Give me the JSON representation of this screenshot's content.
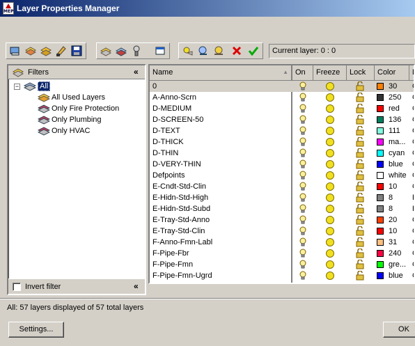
{
  "window": {
    "title": "Layer Properties Manager",
    "app_icon_text": "MEP"
  },
  "toolbar": {
    "current_layer_label": "Current layer: 0 : 0",
    "buttons": [
      "new-property-filter",
      "new-group-filter",
      "layer-states-manager",
      "set-current",
      "save",
      "new-layer",
      "new-layer-vp-frozen",
      "delete-layer",
      "refresh",
      "new-layer-2",
      "layer-settings",
      "layer-key-styles",
      "delete",
      "set-current-check"
    ]
  },
  "filters": {
    "header": "Filters",
    "collapse_glyph": "«",
    "tree": [
      {
        "label": "All",
        "selected": true,
        "expanded": true
      },
      {
        "label": "All Used Layers"
      },
      {
        "label": "Only Fire Protection"
      },
      {
        "label": "Only Plumbing"
      },
      {
        "label": "Only HVAC"
      }
    ],
    "invert_filter_label": "Invert filter",
    "invert_filter_checked": false
  },
  "layers_table": {
    "columns": [
      "Name",
      "On",
      "Freeze",
      "Lock",
      "Color",
      "L"
    ],
    "rows": [
      {
        "name": "0",
        "color_name": "30",
        "color_hex": "#ff7f00",
        "extra": "C",
        "selected": true
      },
      {
        "name": "A-Anno-Scrn",
        "color_name": "250",
        "color_hex": "#333333",
        "extra": "C"
      },
      {
        "name": "D-MEDIUM",
        "color_name": "red",
        "color_hex": "#ff0000",
        "extra": "C"
      },
      {
        "name": "D-SCREEN-50",
        "color_name": "136",
        "color_hex": "#007f5f",
        "extra": "C"
      },
      {
        "name": "D-TEXT",
        "color_name": "111",
        "color_hex": "#7fffdf",
        "extra": "C"
      },
      {
        "name": "D-THICK",
        "color_name": "ma...",
        "color_hex": "#ff00ff",
        "extra": "C"
      },
      {
        "name": "D-THIN",
        "color_name": "cyan",
        "color_hex": "#00ffff",
        "extra": "C"
      },
      {
        "name": "D-VERY-THIN",
        "color_name": "blue",
        "color_hex": "#0000ff",
        "extra": "C"
      },
      {
        "name": "Defpoints",
        "color_name": "white",
        "color_hex": "#ffffff",
        "extra": "C"
      },
      {
        "name": "E-Cndt-Std-Clin",
        "color_name": "10",
        "color_hex": "#ff0000",
        "extra": "C"
      },
      {
        "name": "E-Hidn-Std-High",
        "color_name": "8",
        "color_hex": "#808080",
        "extra": "H"
      },
      {
        "name": "E-Hidn-Std-Subd",
        "color_name": "8",
        "color_hex": "#808080",
        "extra": "H"
      },
      {
        "name": "E-Tray-Std-Anno",
        "color_name": "20",
        "color_hex": "#ff3f00",
        "extra": "C"
      },
      {
        "name": "E-Tray-Std-Clin",
        "color_name": "10",
        "color_hex": "#ff0000",
        "extra": "C"
      },
      {
        "name": "F-Anno-Fmn-Labl",
        "color_name": "31",
        "color_hex": "#ffbf7f",
        "extra": "C"
      },
      {
        "name": "F-Pipe-Fbr",
        "color_name": "240",
        "color_hex": "#ff0040",
        "extra": "C"
      },
      {
        "name": "F-Pipe-Fmn",
        "color_name": "gre...",
        "color_hex": "#00ff00",
        "extra": "C"
      },
      {
        "name": "F-Pipe-Fmn-Ugrd",
        "color_name": "blue",
        "color_hex": "#0000ff",
        "extra": "C"
      }
    ]
  },
  "status": {
    "text": "All: 57 layers displayed of 57 total layers"
  },
  "footer": {
    "settings_label": "Settings...",
    "ok_label": "OK"
  }
}
